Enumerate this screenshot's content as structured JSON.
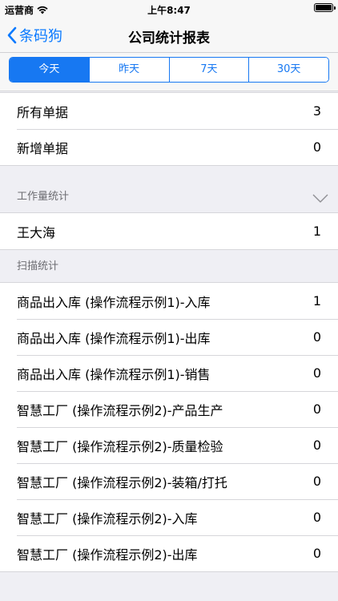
{
  "status": {
    "carrier": "运营商",
    "time": "上午8:47"
  },
  "nav": {
    "back_label": "条码狗",
    "title": "公司统计报表"
  },
  "tabs": [
    {
      "label": "今天",
      "active": true
    },
    {
      "label": "昨天",
      "active": false
    },
    {
      "label": "7天",
      "active": false
    },
    {
      "label": "30天",
      "active": false
    }
  ],
  "summary": [
    {
      "label": "所有单据",
      "value": "3"
    },
    {
      "label": "新增单据",
      "value": "0"
    }
  ],
  "workload": {
    "header": "工作量统计",
    "rows": [
      {
        "label": "王大海",
        "value": "1"
      }
    ]
  },
  "scan": {
    "header": "扫描统计",
    "rows": [
      {
        "label": "商品出入库 (操作流程示例1)-入库",
        "value": "1"
      },
      {
        "label": "商品出入库 (操作流程示例1)-出库",
        "value": "0"
      },
      {
        "label": "商品出入库 (操作流程示例1)-销售",
        "value": "0"
      },
      {
        "label": "智慧工厂 (操作流程示例2)-产品生产",
        "value": "0"
      },
      {
        "label": "智慧工厂 (操作流程示例2)-质量检验",
        "value": "0"
      },
      {
        "label": "智慧工厂 (操作流程示例2)-装箱/打托",
        "value": "0"
      },
      {
        "label": "智慧工厂 (操作流程示例2)-入库",
        "value": "0"
      },
      {
        "label": "智慧工厂 (操作流程示例2)-出库",
        "value": "0"
      }
    ]
  },
  "colors": {
    "accent": "#1778f2",
    "back": "#0a7aff",
    "background": "#efeff4"
  },
  "icons": {
    "back": "chevron-left-icon",
    "collapse": "chevron-down-icon",
    "wifi": "wifi-icon",
    "battery": "battery-icon"
  }
}
